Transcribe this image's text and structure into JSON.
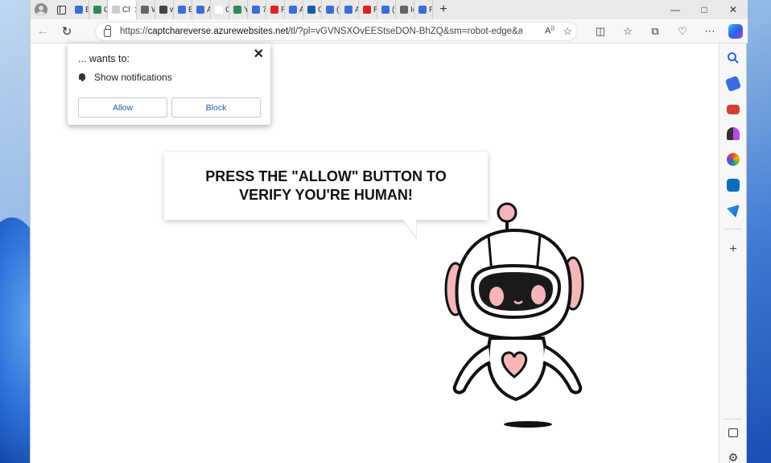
{
  "tabs": [
    {
      "label": "B",
      "favicon_color": "#3b6fd8",
      "active": false
    },
    {
      "label": "O",
      "favicon_color": "#2e8b57",
      "active": false
    },
    {
      "label": "Cl",
      "favicon_color": "#cccccc",
      "active": true
    },
    {
      "label": "W",
      "favicon_color": "#666666",
      "active": false
    },
    {
      "label": "w",
      "favicon_color": "#444444",
      "active": false
    },
    {
      "label": "B",
      "favicon_color": "#3b6fd8",
      "active": false
    },
    {
      "label": "A",
      "favicon_color": "#3b6fd8",
      "active": false
    },
    {
      "label": "C",
      "favicon_color": "#ffffff",
      "active": false
    },
    {
      "label": "Y",
      "favicon_color": "#2e8b57",
      "active": false
    },
    {
      "label": "7",
      "favicon_color": "#3b6fd8",
      "active": false
    },
    {
      "label": "R",
      "favicon_color": "#d22",
      "active": false
    },
    {
      "label": "A",
      "favicon_color": "#3b6fd8",
      "active": false
    },
    {
      "label": "C",
      "favicon_color": "#1f5aa6",
      "active": false
    },
    {
      "label": "(",
      "favicon_color": "#3b6fd8",
      "active": false
    },
    {
      "label": "A",
      "favicon_color": "#3b6fd8",
      "active": false
    },
    {
      "label": "R",
      "favicon_color": "#d22",
      "active": false
    },
    {
      "label": "(",
      "favicon_color": "#3b6fd8",
      "active": false
    },
    {
      "label": "Ic",
      "favicon_color": "#666666",
      "active": false
    },
    {
      "label": "F",
      "favicon_color": "#3b6fd8",
      "active": false
    }
  ],
  "address_bar": {
    "url_prefix": "https://",
    "url_host": "captchareverse.azurewebsites.net",
    "url_rest": "/tl/?pl=vGVNSXOvEEStseDON-BhZQ&sm=robot-edge&app..."
  },
  "permission_prompt": {
    "title": "... wants to:",
    "permission": "Show notifications",
    "allow_label": "Allow",
    "block_label": "Block"
  },
  "page": {
    "headline": "PRESS THE \"ALLOW\" BUTTON TO VERIFY YOU'RE HUMAN!"
  },
  "sidebar": {
    "icons": [
      "search-icon",
      "shopping-tag-icon",
      "toolbox-icon",
      "chess-piece-icon",
      "office-icon",
      "outlook-icon",
      "send-icon",
      "add-icon",
      "split-screen-icon",
      "settings-icon"
    ]
  },
  "colors": {
    "robot_pink": "#f4b6b8",
    "robot_outline": "#111111",
    "link_blue": "#1f5aa6"
  }
}
